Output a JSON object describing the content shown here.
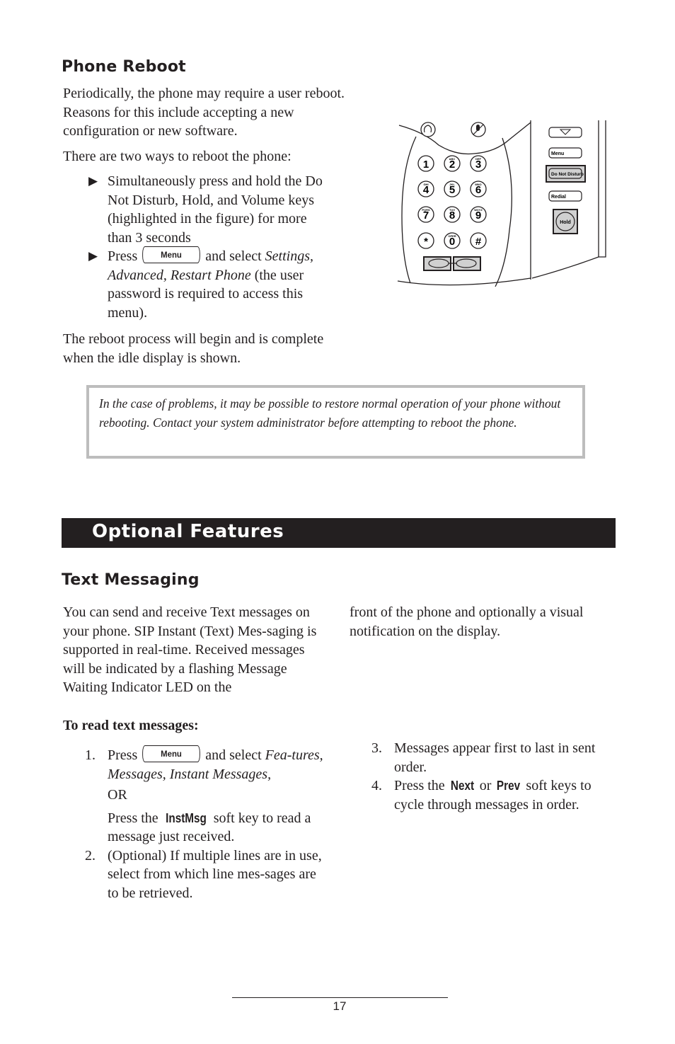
{
  "phone_reboot": {
    "heading": "Phone Reboot",
    "intro": "Periodically, the phone may require a user reboot.  Reasons for this include accepting a new configuration or new software.",
    "ways_intro": "There are two ways to reboot the phone:",
    "bullet_icon": "▶",
    "bullet1": "Simultaneously press and hold the Do Not Disturb, Hold, and Volume keys (highlighted in the figure) for more than 3 seconds",
    "bullet2_pre": "Press",
    "bullet2_key": "Menu",
    "bullet2_mid": "and select",
    "bullet2_italic": "Settings, Advanced, Restart Phone",
    "bullet2_post": "(the user password is required to access this menu).",
    "outro": "The reboot process will begin and is complete when the idle display is shown."
  },
  "phone_figure": {
    "keys": [
      {
        "digit": "1",
        "letters": ""
      },
      {
        "digit": "2",
        "letters": "ABC"
      },
      {
        "digit": "3",
        "letters": "DEF"
      },
      {
        "digit": "4",
        "letters": "GHI"
      },
      {
        "digit": "5",
        "letters": "JKL"
      },
      {
        "digit": "6",
        "letters": "MNO"
      },
      {
        "digit": "7",
        "letters": "PQRS"
      },
      {
        "digit": "8",
        "letters": "TUV"
      },
      {
        "digit": "9",
        "letters": "WXYZ"
      },
      {
        "digit": "*",
        "letters": ""
      },
      {
        "digit": "0",
        "letters": "OPER"
      },
      {
        "digit": "#",
        "letters": ""
      }
    ],
    "menu_label": "Menu",
    "dnd_label": "Do Not Disturb",
    "redial_label": "Redial",
    "hold_label": "Hold",
    "highlight_color": "#d0d0d0"
  },
  "note": {
    "text": "In the case of problems, it may be possible to restore normal operation of your phone without rebooting.  Contact your system administrator before attempting to reboot the phone."
  },
  "banner": {
    "title": "Optional Features"
  },
  "text_messaging": {
    "heading": "Text Messaging",
    "intro": "You can send and receive Text messages on your phone.  SIP Instant (Text) Messaging is supported in real-time.  Received messages will be indicated by a flashing Message Waiting Indicator LED on the front of the phone and optionally a visual notification on the display.",
    "intro_col1": "You can send and receive Text messages on your phone.  SIP Instant (Text) Mes-saging is supported in real-time.  Received messages will be indicated by a flashing Message Waiting Indicator LED on the",
    "intro_col2": "front of the phone and optionally a visual notification on the display.",
    "read_heading": "To read text messages:",
    "step1_num": "1.",
    "step1_pre": "Press",
    "step1_key": "Menu",
    "step1_mid": "and select",
    "step1_italic": "Fea-tures, Messages, Instant Messages,",
    "step1_or": "OR",
    "step1_alt_pre": "Press the",
    "step1_alt_key": "InstMsg",
    "step1_alt_post": "soft key to read a message just received.",
    "step2_num": "2.",
    "step2": "(Optional)  If multiple lines are in use, select from which line mes-sages are to be retrieved.",
    "step3_num": "3.",
    "step3": "Messages appear first to last in sent order.",
    "step4_num": "4.",
    "step4_pre": "Press the",
    "step4_key1": "Next",
    "step4_or": "or",
    "step4_key2": "Prev",
    "step4_post": "soft keys to cycle through messages in order."
  },
  "footer": {
    "page_number": "17"
  }
}
